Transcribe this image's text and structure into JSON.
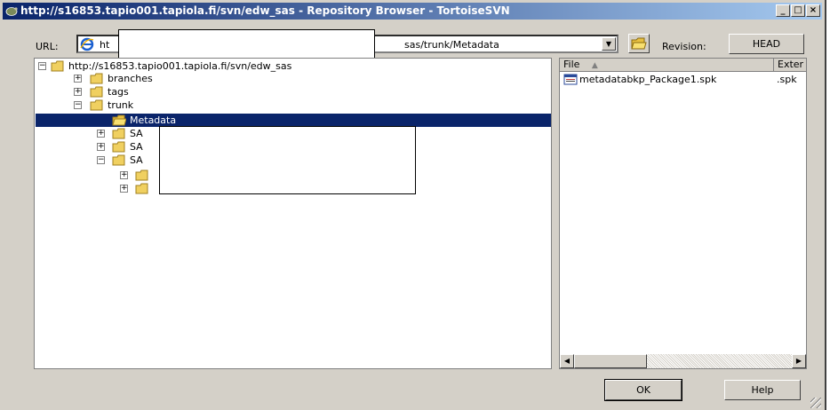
{
  "window": {
    "title": "http://s16853.tapio001.tapiola.fi/svn/edw_sas - Repository Browser - TortoiseSVN",
    "caption_buttons": [
      "_",
      "□",
      "×"
    ]
  },
  "toolbar": {
    "url_label": "URL:",
    "url_visible_start": "ht",
    "url_visible_end": "sas/trunk/Metadata",
    "revision_label": "Revision:",
    "revision_value": "HEAD"
  },
  "tree": {
    "root_label": "http://s16853.tapio001.tapiola.fi/svn/edw_sas",
    "items": [
      {
        "label": "branches"
      },
      {
        "label": "tags"
      },
      {
        "label": "trunk"
      },
      {
        "label": "Metadata"
      },
      {
        "label": "SA"
      },
      {
        "label": "SA"
      },
      {
        "label": "SA"
      }
    ]
  },
  "files": {
    "columns": [
      "File",
      "Exter"
    ],
    "rows": [
      {
        "name": "metadatabkp_Package1.spk",
        "ext": ".spk"
      }
    ]
  },
  "buttons": {
    "ok": "OK",
    "help": "Help"
  },
  "colors": {
    "titlebar_start": "#0a246a",
    "selection": "#0a246a",
    "face": "#d4d0c8"
  },
  "icons": {
    "app": "tortoisesvn-icon",
    "url": "internet-explorer-icon",
    "folder": "folder-icon",
    "file": "package-file-icon"
  }
}
